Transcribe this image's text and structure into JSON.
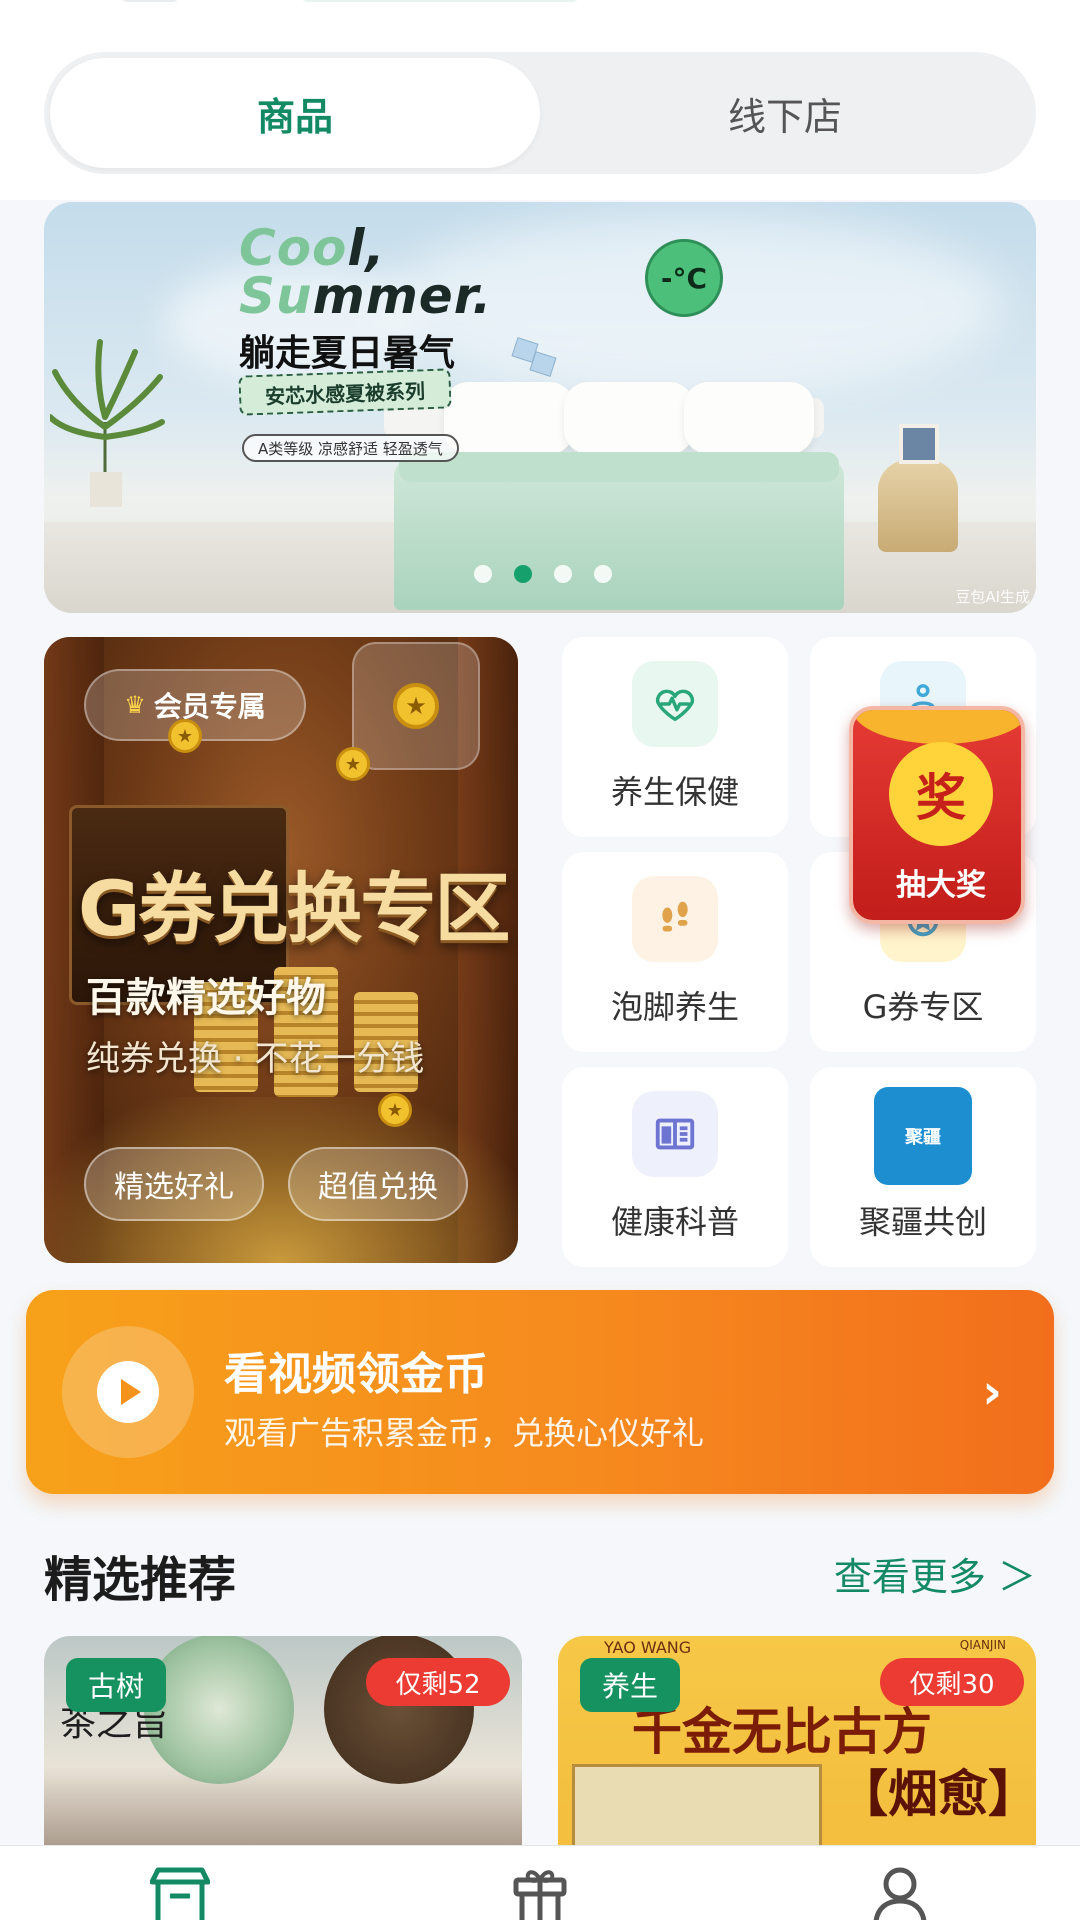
{
  "segment": {
    "tabs": [
      {
        "label": "商品",
        "active": true
      },
      {
        "label": "线下店",
        "active": false
      }
    ]
  },
  "banner": {
    "headline_line1_green": "Coo",
    "headline_line1_dark": "l,",
    "headline_line2_green": "Su",
    "headline_line2_dark": "mmer.",
    "title": "躺走夏日暑气",
    "series": "安芯水感夏被系列",
    "tags": "A类等级  凉感舒适  轻盈透气",
    "temp_badge": "-°C",
    "watermark": "豆包AI生成",
    "dots_count": 4,
    "active_dot": 1
  },
  "promo": {
    "badge": "会员专属",
    "title": "G券兑换专区",
    "subtitle": "百款精选好物",
    "tagline": "纯券兑换 · 不花一分钱",
    "buttons": [
      "精选好礼",
      "超值兑换"
    ]
  },
  "categories": [
    {
      "label": "养生保健",
      "icon": "heart-pulse-icon"
    },
    {
      "label": "",
      "icon": "meditation-icon"
    },
    {
      "label": "泡脚养生",
      "icon": "footprints-icon"
    },
    {
      "label": "G券专区",
      "icon": "medal-icon"
    },
    {
      "label": "健康科普",
      "icon": "book-icon"
    },
    {
      "label": "聚疆共创",
      "icon": "juliang-logo",
      "logo_text": "聚疆"
    }
  ],
  "lottery": {
    "char": "奖",
    "label": "抽大奖"
  },
  "video_bar": {
    "title": "看视频领金币",
    "subtitle": "观看广告积累金币，兑换心仪好礼",
    "arrow": "›"
  },
  "section": {
    "title": "精选推荐",
    "more": "查看更多 ＞"
  },
  "products": [
    {
      "tag": "古树",
      "stock": "仅剩52",
      "calligraphy": "茶之旨"
    },
    {
      "tag": "养生",
      "stock": "仅剩30",
      "brand": "YAO WANG",
      "brand_right": "QIANJIN",
      "text_line1": "千金无比古方",
      "text_line2": "【烟愈】"
    }
  ],
  "colors": {
    "primary": "#148a64",
    "orange": "#f68a1e",
    "red": "#ec3b33"
  }
}
